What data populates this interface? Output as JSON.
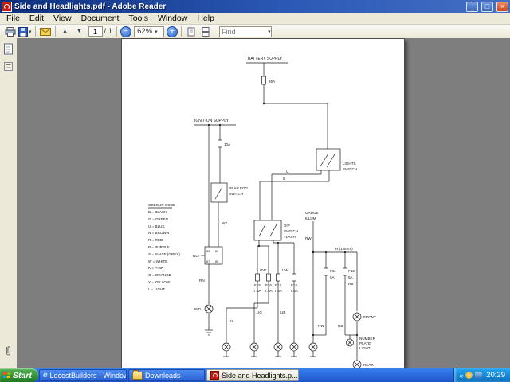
{
  "window": {
    "title": "Side and Headlights.pdf - Adobe Reader",
    "menu": [
      "File",
      "Edit",
      "View",
      "Document",
      "Tools",
      "Window",
      "Help"
    ]
  },
  "toolbar": {
    "page_current": "1",
    "page_total": "/ 1",
    "zoom_level": "62%",
    "find_placeholder": "Find"
  },
  "icons": {
    "minimize": "_",
    "maximize": "□",
    "close": "×",
    "page_up": "▲",
    "page_down": "▼",
    "zoom_out": "−",
    "zoom_in": "+",
    "dropdown": "▾",
    "tray_collapse": "«",
    "ie": "e"
  },
  "diagram": {
    "battery_supply": "BATTERY SUPPLY",
    "fuse_main": "25A",
    "ignition_supply": "IGNITION SUPPLY",
    "fuse_ignition": "10A",
    "lights_switch": [
      "LIGHTS",
      "SWITCH"
    ],
    "rear_fog_switch": [
      "REAR FOG",
      "SWITCH"
    ],
    "dip_switch": [
      "DIP",
      "SWITCH",
      "FLASH"
    ],
    "gauge_illum": [
      "GAUGE",
      "ILLUM"
    ],
    "relay_label": "RLY",
    "relay_terminals": [
      "30",
      "86",
      "87",
      "85"
    ],
    "ind_label": "IND",
    "front_label": "FRONT",
    "number_plate": [
      "NUMBER",
      "PLATE",
      "LIGHT"
    ],
    "rear_label": "REAR",
    "wire_labels": {
      "wy": "WY",
      "u_main": "U",
      "u_dip": "U",
      "rw_gauge": "RW",
      "rw_front": "RW",
      "rb_fuse": "RB",
      "rb_rear": "RB",
      "rn": "RN",
      "us": "US",
      "ug": "UG",
      "ub": "UB",
      "uw_left": "UW",
      "uw_right": "UW",
      "r_feed": "R (1.5mm)"
    },
    "fuse_labels": {
      "f15": "F15",
      "f16": "F16",
      "f13": "F13",
      "f14": "F14",
      "f11": "F11",
      "f12": "F12",
      "amp75": "7.5A",
      "amp5": "5A"
    },
    "colour_code": {
      "title": "COLOUR CODE",
      "entries": [
        "B = BLACK",
        "G = GREEN",
        "U = BLUE",
        "N = BROWN",
        "R = RED",
        "P = PURPLE",
        "S = SLATE (GREY)",
        "W = WHITE",
        "K = PINK",
        "O = ORANGE",
        "Y = YELLOW",
        "L = LIGHT"
      ]
    }
  },
  "taskbar": {
    "start_label": "Start",
    "tasks": [
      {
        "label": "LocostBuilders - Window..."
      },
      {
        "label": "Downloads"
      },
      {
        "label": "Side and Headlights.p..."
      }
    ],
    "clock": "20:29"
  }
}
